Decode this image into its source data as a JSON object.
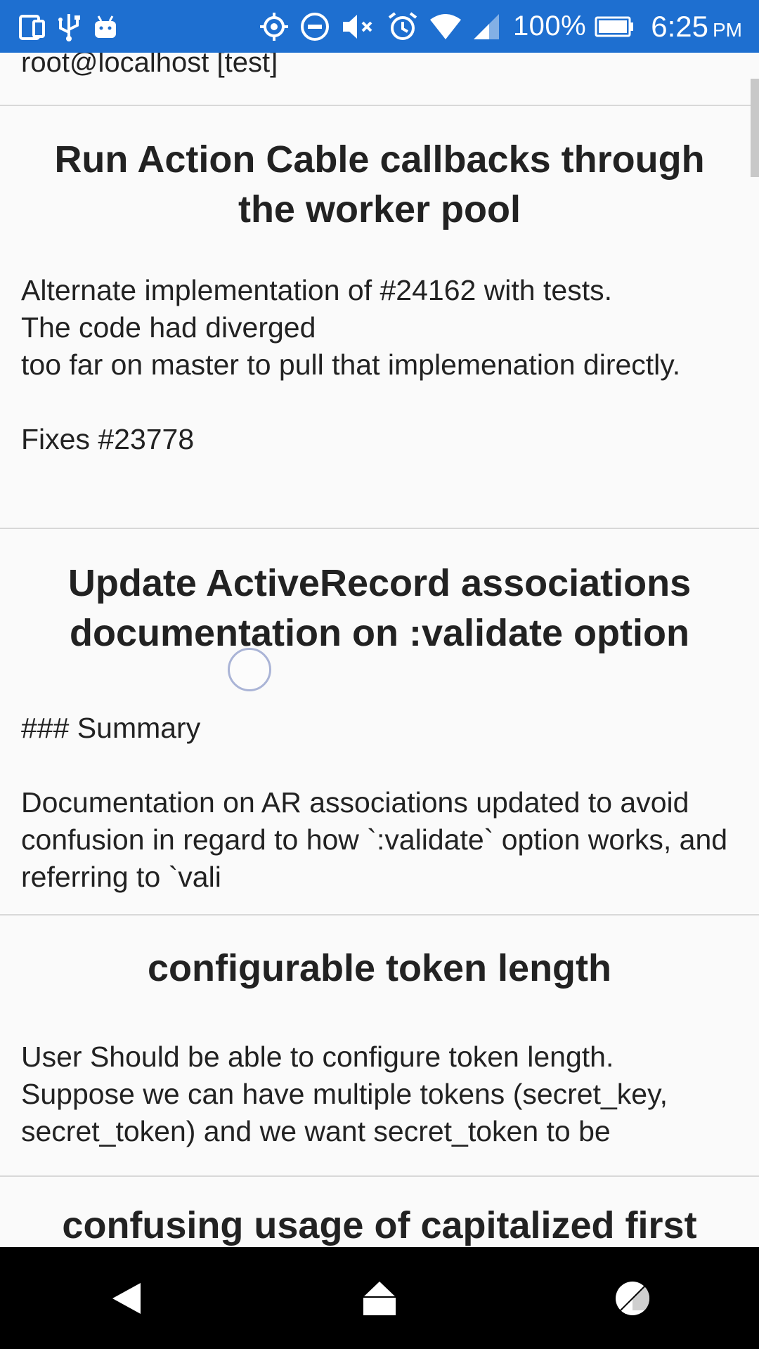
{
  "status_bar": {
    "left_icons": [
      "screen-mirror-icon",
      "usb-icon",
      "android-debug-icon"
    ],
    "right_icons": [
      "gps-icon",
      "do-not-disturb-icon",
      "mute-icon",
      "alarm-icon",
      "wifi-icon",
      "signal-icon"
    ],
    "battery_percent": "100%",
    "battery_icon": "battery-icon",
    "time": "6:25",
    "ampm": "PM",
    "background_color": "#1e6fd0"
  },
  "connection": {
    "label": "root@localhost [test]"
  },
  "items": [
    {
      "title": "Run Action Cable callbacks through the worker pool",
      "body": "Alternate implementation of #24162 with tests.\nThe code had diverged\ntoo far on master to pull that implemenation directly.\n\nFixes #23778"
    },
    {
      "title": "Update ActiveRecord associations documentation on :validate option",
      "body": "### Summary\n\nDocumentation on AR associations updated to avoid confusion in regard to how `:validate` option works, and referring to `vali"
    },
    {
      "title": "configurable token length",
      "body": "User Should be able to configure token length.\nSuppose we can have multiple tokens (secret_key, secret_token) and we want secret_token to be"
    },
    {
      "title": "confusing usage of capitalized first",
      "body": ""
    }
  ],
  "nav_bar": {
    "back": "back-icon",
    "home": "home-icon",
    "recents": "recents-icon"
  }
}
